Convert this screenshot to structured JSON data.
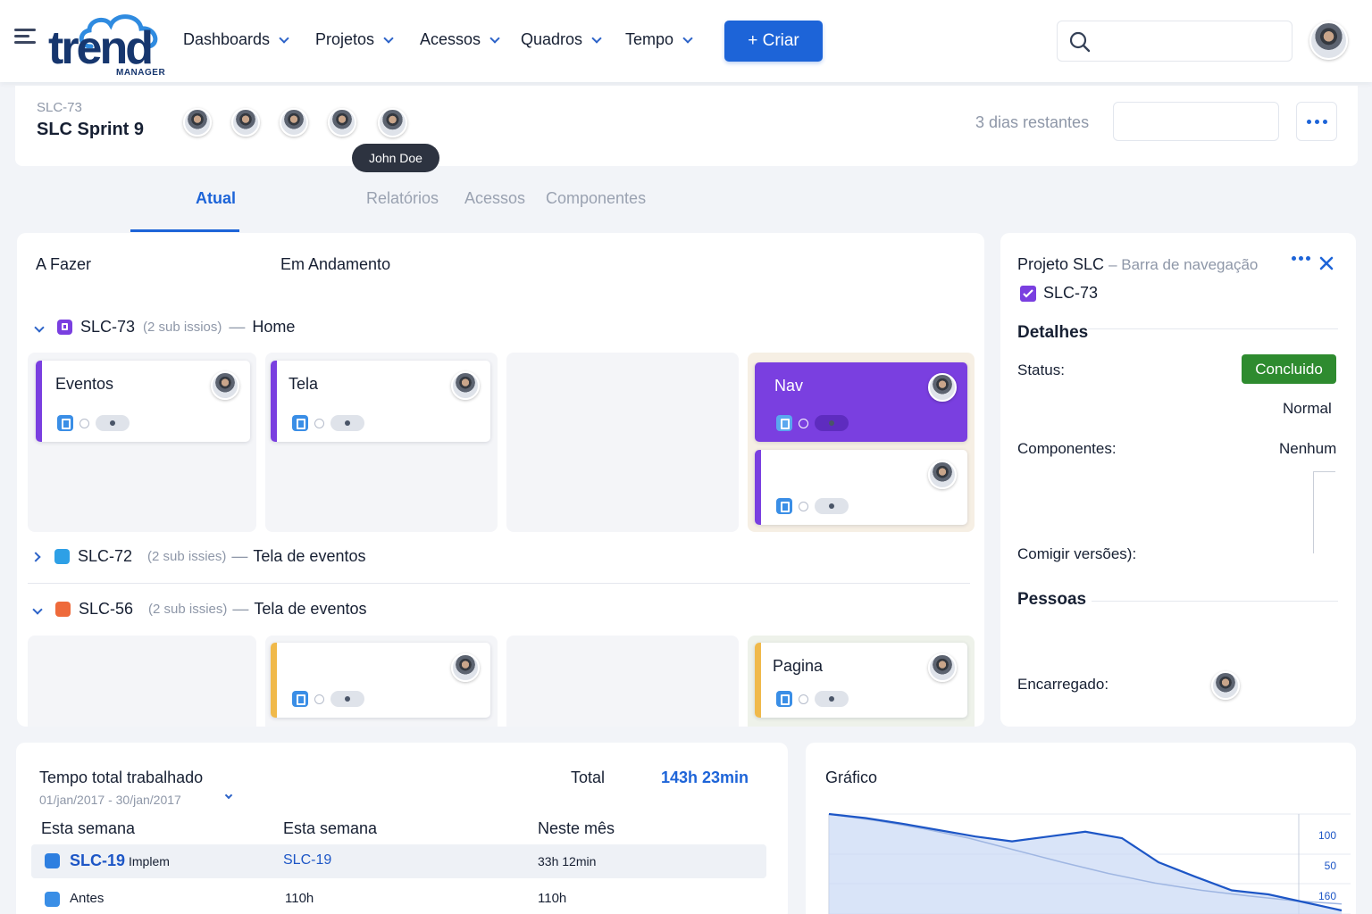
{
  "brand": {
    "word": "trend",
    "sub": "MANAGER"
  },
  "nav": [
    {
      "label": "Dashboards"
    },
    {
      "label": "Projetos"
    },
    {
      "label": "Acessos"
    },
    {
      "label": "Quadros"
    },
    {
      "label": "Tempo"
    }
  ],
  "create_label": "+ Criar",
  "sprint": {
    "key": "SLC-73",
    "name": "SLC Sprint 9",
    "remaining": "3 dias restantes",
    "tooltip": "John Doe"
  },
  "tabs": [
    {
      "label": "Atual"
    },
    {
      "label": "Relatórios"
    },
    {
      "label": "Acessos"
    },
    {
      "label": "Componentes"
    }
  ],
  "board": {
    "columns": [
      "A Fazer",
      "Em Andamento"
    ],
    "groups": [
      {
        "key": "SLC-73",
        "sub": "(2 sub issios)",
        "title": "Home",
        "color": "#7a3fe0"
      },
      {
        "key": "SLC-72",
        "sub": "(2 sub issies)",
        "title": "Tela de eventos",
        "color": "#2ea0e6"
      },
      {
        "key": "SLC-56",
        "sub": "(2 sub issies)",
        "title": "Tela de eventos",
        "color": "#ee6a3b"
      }
    ],
    "cards": {
      "eventos": "Eventos",
      "tela": "Tela",
      "nav": "Nav",
      "pagina": "Pagina"
    }
  },
  "detail": {
    "project": "Projeto SLC",
    "subtitle": "– Barra de navegação",
    "key": "SLC-73",
    "section_details": "Detalhes",
    "status_label": "Status:",
    "status_value": "Concluido",
    "priority": "Normal",
    "components_label": "Componentes:",
    "components_value": "Nenhum",
    "versions_label": "Comigir versões):",
    "section_people": "Pessoas",
    "assignee_label": "Encarregado:"
  },
  "time": {
    "title": "Tempo total trabalhado",
    "range": "01/jan/2017 - 30/jan/2017",
    "total_label": "Total",
    "total_value": "143h 23min",
    "headers": [
      "Esta semana",
      "Esta semana",
      "Neste mês"
    ],
    "rows": [
      {
        "key": "SLC-19",
        "desc": "Implem",
        "week": "SLC-19",
        "month": "33h 12min"
      },
      {
        "key": "Antes",
        "desc": "",
        "week": "110h",
        "month": "110h"
      }
    ]
  },
  "chart_panel": {
    "title": "Gráfico"
  },
  "chart_data": {
    "type": "area",
    "title": "Gráfico",
    "y_tick_labels": [
      "100",
      "50",
      "160"
    ],
    "series": [
      {
        "values": [
          100,
          95,
          88,
          80,
          72,
          66,
          72,
          78,
          70,
          40,
          22,
          5,
          0,
          -10,
          -20
        ]
      },
      {
        "values": [
          100,
          92,
          82,
          70,
          55,
          40,
          26,
          14,
          5,
          -2,
          -8,
          -12
        ]
      }
    ],
    "grid": true,
    "colors": {
      "fill": "#c9d8f5",
      "line": "#1d56c6",
      "line2": "#9fb6e2"
    }
  },
  "colors": {
    "accent": "#1d64d8",
    "purple": "#7a3fe0",
    "orange": "#f0b94a",
    "success": "#2e8b2f"
  }
}
